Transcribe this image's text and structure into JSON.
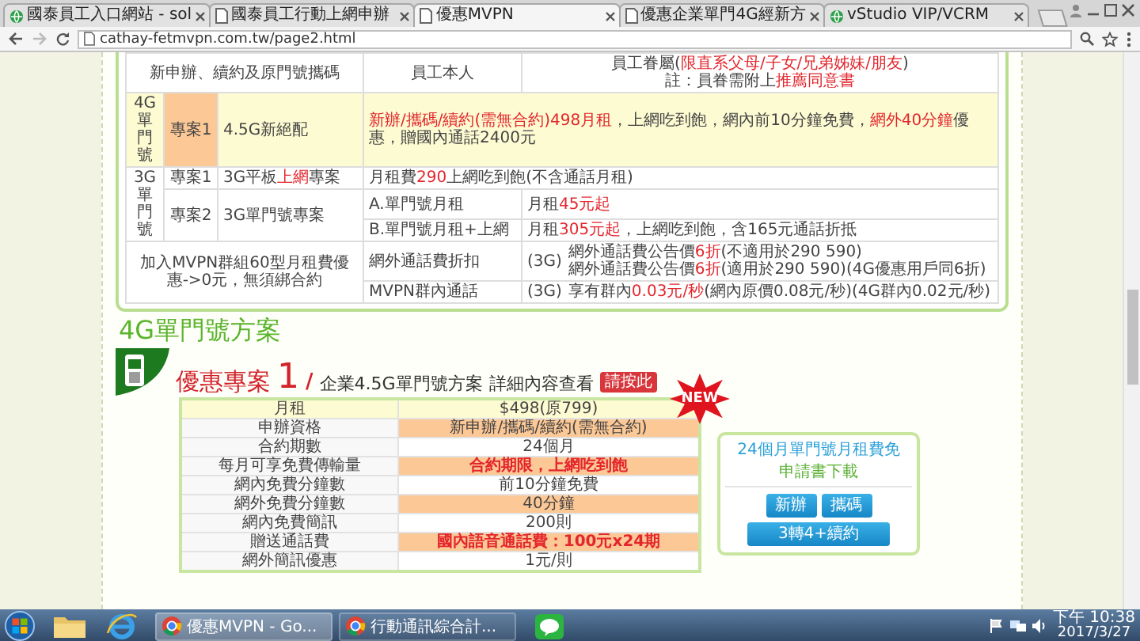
{
  "browser": {
    "tabs": [
      {
        "title": "國泰員工入口網站 - sol",
        "kind": "site",
        "selected": false
      },
      {
        "title": "國泰員工行動上網申辦",
        "kind": "page",
        "selected": false
      },
      {
        "title": "優惠MVPN",
        "kind": "page",
        "selected": true
      },
      {
        "title": "優惠企業單門4G經新方",
        "kind": "page",
        "selected": false
      },
      {
        "title": "vStudio VIP/VCRM",
        "kind": "site",
        "selected": false
      }
    ],
    "address": "cathay-fetmvpn.com.tw/page2.html"
  },
  "staff_table": {
    "header": {
      "applicant": "新申辦、續約及原門號攜碼",
      "staff": "員工本人",
      "family": "員工眷屬(**限直系父母/子女/兄弟姊妹/朋友**)",
      "family_note": "註：員眷需附上**推薦同意書**"
    },
    "groups": [
      {
        "label": "4G單門號",
        "highlighted": true,
        "plans": [
          {
            "name": "專案1",
            "title": "4.5G新絕配",
            "options": [
              {
                "detail": "**新辦/攜碼/續約(需無合約)498月租**，上網吃到飽，網內前10分鐘免費，**網外40分鐘**優惠，贈國內通話2400元"
              }
            ]
          }
        ]
      },
      {
        "label": "3G單門號",
        "highlighted": false,
        "plans": [
          {
            "name": "專案1",
            "title": "3G平板**上網**專案",
            "options": [
              {
                "detail": "月租費**290**上網吃到飽(不含通話月租)"
              }
            ]
          },
          {
            "name": "專案2",
            "title": "3G單門號專案",
            "options": [
              {
                "option": "A.單門號月租",
                "detail": "月租**45元起**"
              },
              {
                "option": "B.單門號月租+上網",
                "detail": "月租**305元起**，上網吃到飽，含165元通話折抵"
              }
            ]
          }
        ]
      }
    ],
    "mvpn": {
      "label": "加入MVPN群組60型月租費優惠->0元，無須綁合約",
      "items": [
        {
          "name": "網外通話費折扣",
          "network": "(3G)",
          "lines": [
            "網外通話費公告價**6折**(不適用於290 590)",
            "網外通話費公告價**6折**(適用於290 590)(4G優惠用戶同6折)"
          ]
        },
        {
          "name": "MVPN群內通話",
          "network": "(3G)",
          "lines": [
            "享有群內**0.03元/秒**(網內原價0.08元/秒)(4G群內0.02元/秒)"
          ]
        }
      ]
    }
  },
  "plan_section": {
    "heading": "4G單門號方案",
    "promo": {
      "label": "優惠專案",
      "number": "1",
      "separator": "/",
      "title": "企業4.5G單門號方案",
      "detail_label": "詳細內容查看",
      "detail_button": "請按此"
    },
    "new_badge": "NEW",
    "rows": [
      {
        "label": "月租",
        "value": "$498(原799)",
        "kind": "header",
        "highlighted": false,
        "emphasized": false
      },
      {
        "label": "申辦資格",
        "value": "新申辦/攜碼/續約(需無合約)",
        "kind": "row",
        "highlighted": true,
        "emphasized": false
      },
      {
        "label": "合約期數",
        "value": "24個月",
        "kind": "row",
        "highlighted": false,
        "emphasized": false
      },
      {
        "label": "每月可享免費傳輸量",
        "value": "合約期限，上網吃到飽",
        "kind": "row",
        "highlighted": true,
        "emphasized": true
      },
      {
        "label": "網內免費分鐘數",
        "value": "前10分鐘免費",
        "kind": "row",
        "highlighted": false,
        "emphasized": false
      },
      {
        "label": "網外免費分鐘數",
        "value": "40分鐘",
        "kind": "row",
        "highlighted": true,
        "emphasized": false
      },
      {
        "label": "網內免費簡訊",
        "value": "200則",
        "kind": "row",
        "highlighted": false,
        "emphasized": false
      },
      {
        "label": "贈送通話費",
        "value": "國內語音通話費：100元x24期",
        "kind": "row",
        "highlighted": true,
        "emphasized": true
      },
      {
        "label": "網外簡訊優惠",
        "value": "1元/則",
        "kind": "row",
        "highlighted": false,
        "emphasized": false
      }
    ],
    "download_box": {
      "title": "24個月單門號月租費免",
      "subtitle": "申請書下載",
      "buttons": [
        "新辦",
        "攜碼",
        "3轉4+續約"
      ]
    }
  },
  "taskbar": {
    "windows": [
      {
        "title": "優惠MVPN - Go...",
        "selected": true
      },
      {
        "title": "行動通訊綜合計...",
        "selected": false
      }
    ],
    "time": "下午 10:38",
    "date": "2017/3/27"
  }
}
